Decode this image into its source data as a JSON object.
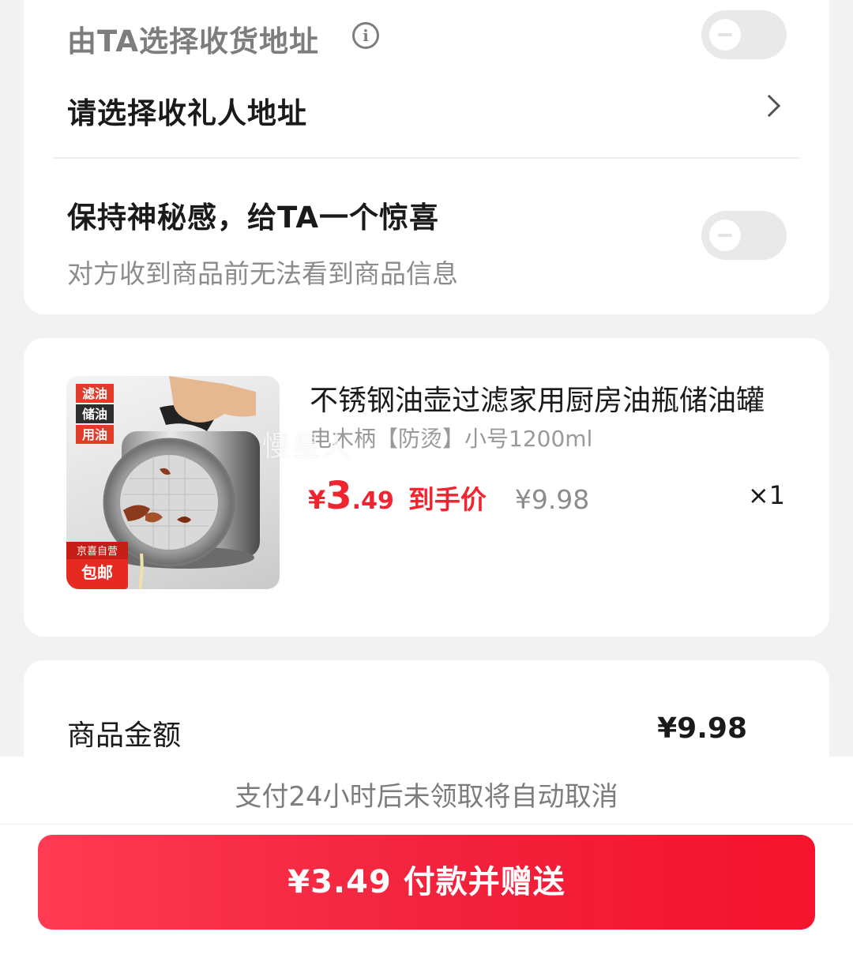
{
  "address": {
    "let_recipient_choose_label": "由TA选择收货地址",
    "select_address_label": "请选择收礼人地址"
  },
  "surprise": {
    "title": "保持神秘感，给TA一个惊喜",
    "description": "对方收到商品前无法看到商品信息"
  },
  "product": {
    "name": "不锈钢油壶过滤家用厨房油瓶储油罐",
    "spec": "电木柄【防烫】小号1200ml",
    "watermark": "慢星人",
    "price_symbol": "¥",
    "price_integer": "3",
    "price_decimal": ".49",
    "price_tag": "到手价",
    "original_price": "¥9.98",
    "quantity": "×1",
    "image_labels": {
      "top_1": "滤油",
      "top_2": "储油",
      "top_3": "用油",
      "badge_1": "京喜自营",
      "badge_2": "包邮"
    }
  },
  "summary": {
    "goods_amount_label": "商品金额",
    "goods_amount_value": "¥9.98"
  },
  "footer": {
    "notice": "支付24小时后未领取将自动取消",
    "pay_button": "¥3.49 付款并赠送"
  },
  "colors": {
    "accent_red": "#f0252f",
    "button_gradient_start": "#ff3a52",
    "button_gradient_end": "#f5132d",
    "toggle_off": "#e9e9e9"
  },
  "icons": {
    "info": "info-icon",
    "chevron": "chevron-right-icon",
    "toggle": "toggle-off"
  },
  "toggles": {
    "let_recipient_choose": false,
    "keep_surprise": false
  }
}
